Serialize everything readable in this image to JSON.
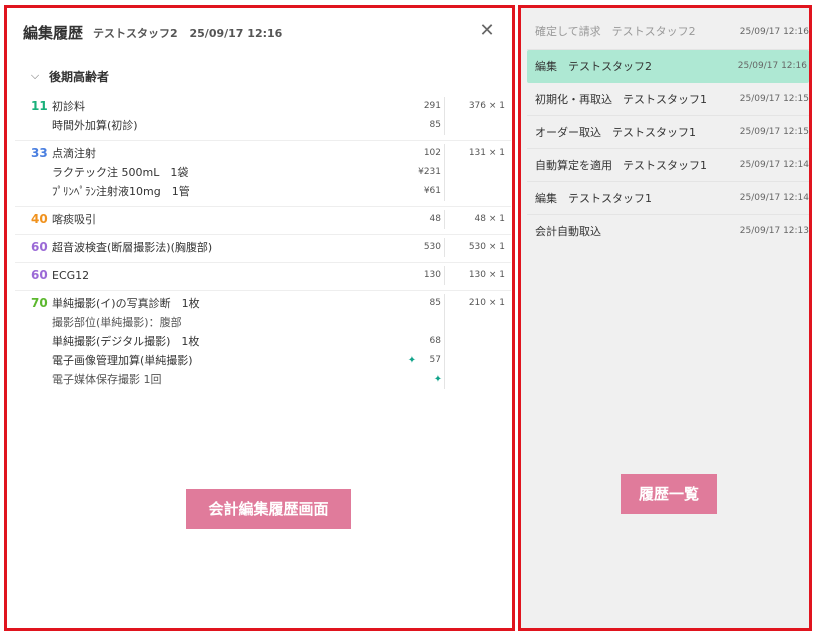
{
  "header": {
    "title": "編集履歴",
    "staff": "テストスタッフ2",
    "datetime": "25/09/17 12:16",
    "close_glyph": "✕"
  },
  "section": {
    "label": "後期高齢者",
    "chevron": "⌵"
  },
  "groups": [
    {
      "code": "11",
      "code_color": "#19b07a",
      "total": "376 × 1",
      "items": [
        {
          "name": "初診料",
          "amount": "291"
        },
        {
          "name": "時間外加算(初診)",
          "amount": "85"
        }
      ]
    },
    {
      "code": "33",
      "code_color": "#4a7fe0",
      "total": "131 × 1",
      "items": [
        {
          "name": "点滴注射",
          "amount": "102"
        },
        {
          "name": "ラクテック注 500mL　1袋",
          "amount": "¥231"
        },
        {
          "name": "ﾌﾟﾘﾝﾍﾟﾗﾝ注射液10mg　1管",
          "amount": "¥61"
        }
      ]
    },
    {
      "code": "40",
      "code_color": "#f0921e",
      "total": "48 × 1",
      "items": [
        {
          "name": "喀痰吸引",
          "amount": "48"
        }
      ]
    },
    {
      "code": "60",
      "code_color": "#9b6ad6",
      "total": "530 × 1",
      "items": [
        {
          "name": "超音波検査(断層撮影法)(胸腹部)",
          "amount": "530"
        }
      ]
    },
    {
      "code": "60",
      "code_color": "#9b6ad6",
      "total": "130 × 1",
      "items": [
        {
          "name": "ECG12",
          "amount": "130"
        }
      ]
    },
    {
      "code": "70",
      "code_color": "#5cb82e",
      "total": "210 × 1",
      "items": [
        {
          "name": "単純撮影(イ)の写真診断　1枚",
          "amount": "85"
        },
        {
          "name": "撮影部位(単純撮影)：腹部",
          "amount": "",
          "sub": true
        },
        {
          "name": "単純撮影(デジタル撮影)　1枚",
          "amount": "68"
        },
        {
          "name": "電子画像管理加算(単純撮影)",
          "amount": "57",
          "spark": true
        },
        {
          "name": "電子媒体保存撮影 1回",
          "amount": "",
          "spark": true,
          "sub": true
        }
      ]
    }
  ],
  "labels": {
    "left": "会計編集履歴画面",
    "right": "履歴一覧"
  },
  "history": [
    {
      "label": "確定して請求　テストスタッフ2",
      "time": "25/09/17 12:16",
      "faded": true
    },
    {
      "label": "編集　テストスタッフ2",
      "time": "25/09/17 12:16",
      "selected": true
    },
    {
      "label": "初期化・再取込　テストスタッフ1",
      "time": "25/09/17 12:15"
    },
    {
      "label": "オーダー取込　テストスタッフ1",
      "time": "25/09/17 12:15"
    },
    {
      "label": "自動算定を適用　テストスタッフ1",
      "time": "25/09/17 12:14"
    },
    {
      "label": "編集　テストスタッフ1",
      "time": "25/09/17 12:14"
    },
    {
      "label": "会計自動取込",
      "time": "25/09/17 12:13"
    }
  ],
  "icons": {
    "sparkle": "ai-sparkle-icon",
    "close": "close-icon",
    "chevron": "chevron-down-icon"
  },
  "colors": {
    "highlight": "#aee8d3",
    "annotation_border": "#e0141e",
    "annotation_label_bg": "#e07b9b"
  }
}
